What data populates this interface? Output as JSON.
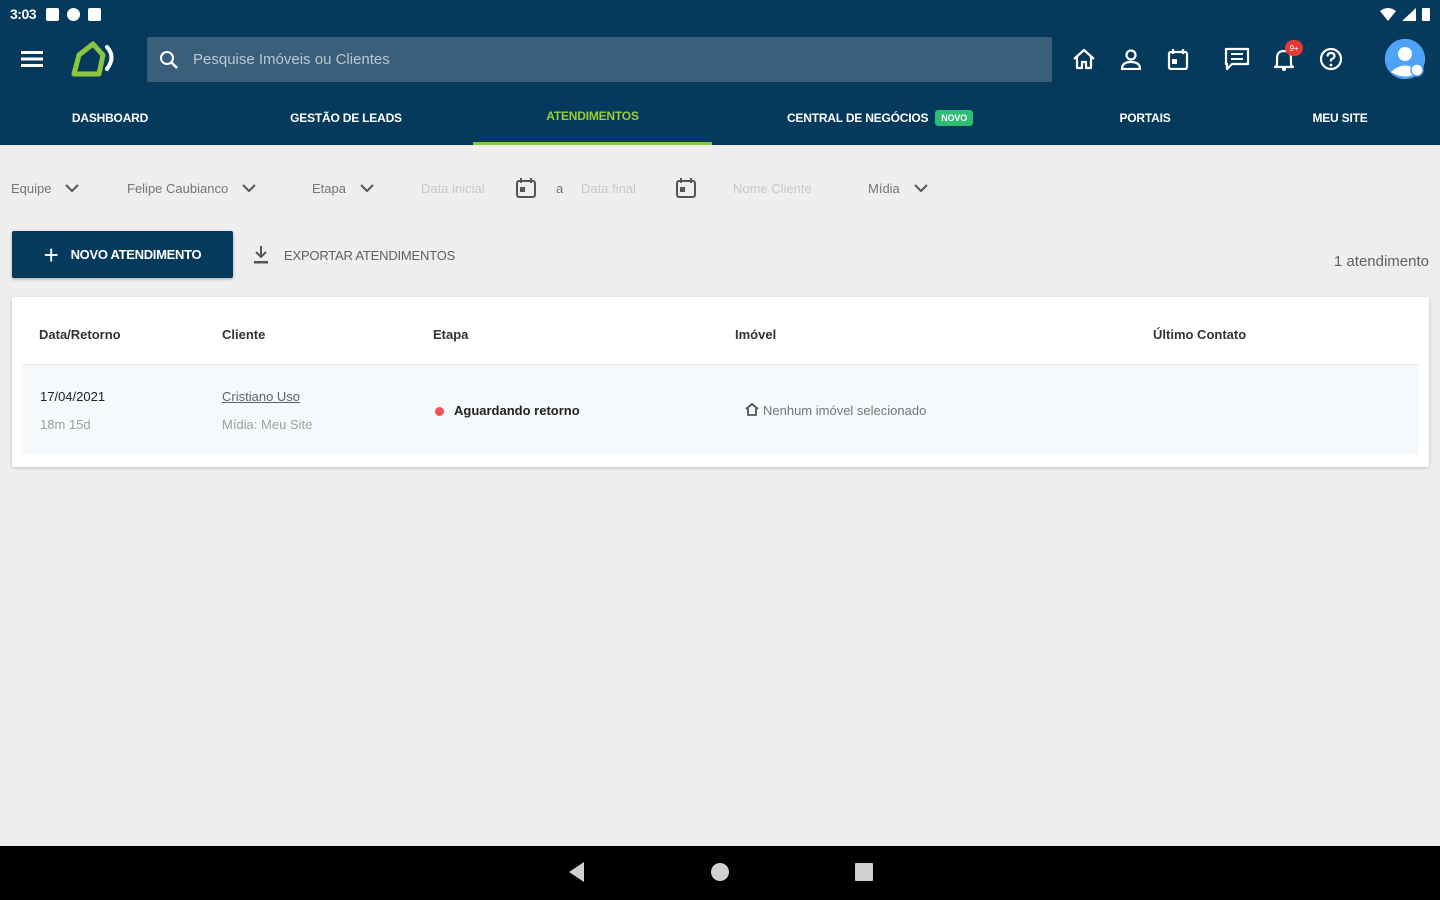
{
  "status_bar": {
    "time": "3:03"
  },
  "search": {
    "placeholder": "Pesquise Imóveis ou Clientes"
  },
  "header_icons": [
    "home-icon",
    "person-icon",
    "calendar-icon",
    "chat-icon",
    "bell-icon",
    "help-icon"
  ],
  "notification_badge": "9+",
  "tabs": [
    {
      "label": "DASHBOARD"
    },
    {
      "label": "GESTÃO DE LEADS"
    },
    {
      "label": "ATENDIMENTOS"
    },
    {
      "label": "CENTRAL DE NEGÓCIOS",
      "badge": "NOVO"
    },
    {
      "label": "PORTAIS"
    },
    {
      "label": "MEU SITE"
    }
  ],
  "active_tab": "ATENDIMENTOS",
  "filters": {
    "team": "Equipe",
    "broker": "Felipe Caubianco",
    "stage": "Etapa",
    "start_date_placeholder": "Data inicial",
    "separator": "a",
    "end_date_placeholder": "Data final",
    "client_name_placeholder": "Nome Cliente",
    "media": "Mídia"
  },
  "actions": {
    "new_label": "NOVO ATENDIMENTO",
    "export_label": "EXPORTAR ATENDIMENTOS",
    "count": "1 atendimento"
  },
  "table": {
    "headers": [
      "Data/Retorno",
      "Cliente",
      "Etapa",
      "Imóvel",
      "Último Contato"
    ],
    "rows": [
      {
        "date": "17/04/2021",
        "elapsed": "18m 15d",
        "client": "Cristiano Uso",
        "media": "Mídia: Meu Site",
        "stage": "Aguardando retorno",
        "property": "Nenhum imóvel selecionado",
        "last_contact": ""
      }
    ]
  },
  "colors": {
    "primary": "#063a5c",
    "accent": "#8cc63f",
    "new_badge": "#2ebd75",
    "stage_dot": "#ef5350"
  }
}
